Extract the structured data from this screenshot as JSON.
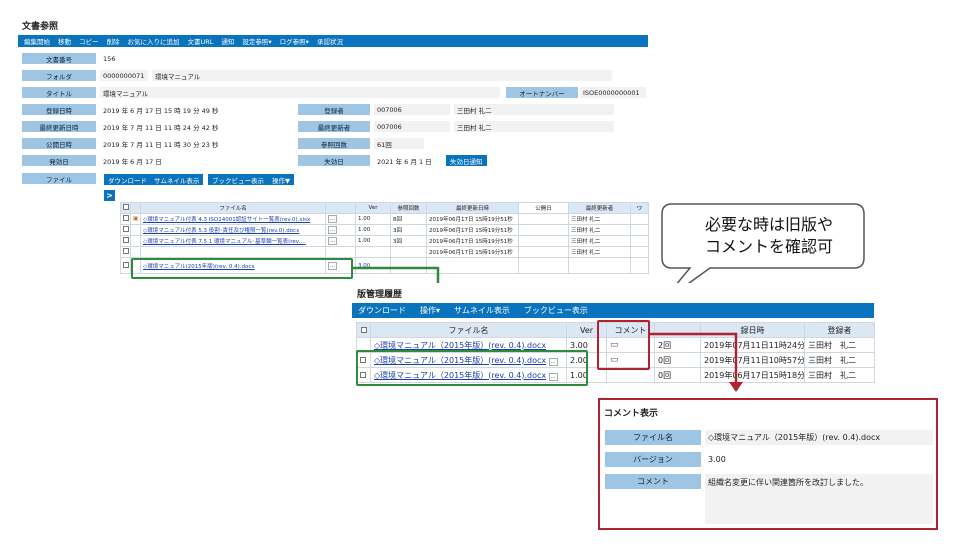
{
  "title": "文書参照",
  "menu": [
    "編集開始",
    "移動",
    "コピー",
    "削除",
    "お気に入りに追加",
    "文書URL",
    "通知",
    "設定参照▾",
    "ログ参照▾",
    "承認状況"
  ],
  "fields": {
    "doc_no_label": "文書番号",
    "doc_no": "156",
    "folder_label": "フォルダ",
    "folder_id": "0000000071",
    "folder_name": "環境マニュアル",
    "title_label": "タイトル",
    "title_value": "環境マニュアル",
    "auto_no_label": "オートナンバー",
    "auto_no": "ISOE0000000001",
    "reg_date_label": "登録日時",
    "reg_date": "2019 年  6  月 17  日  15  時 19  分  49  秒",
    "registrant_label": "登録者",
    "registrant_id": "007006",
    "registrant_name": "三田村 礼二",
    "upd_date_label": "最終更新日時",
    "upd_date": "2019 年  7  月 11  日  11  時 24  分  42  秒",
    "updater_label": "最終更新者",
    "updater_id": "007006",
    "updater_name": "三田村 礼二",
    "pub_date_label": "公開日時",
    "pub_date": "2019 年  7  月 11  日  11  時 30  分  23  秒",
    "ref_count_label": "参照回数",
    "ref_count": "61回",
    "eff_date_label": "発効日",
    "eff_date": "2019 年  6  月 17  日",
    "exp_date_label": "失効日",
    "exp_date": "2021  年  6  月  1  日",
    "exp_notice_button": "失効日通知",
    "file_label": "ファイル"
  },
  "file_buttons": [
    "ダウンロード",
    "サムネイル表示",
    "ブックビュー表示",
    "操作▼"
  ],
  "expand_icon": ">",
  "file_table": {
    "headers": [
      "",
      "",
      "ファイル名",
      "",
      "Ver",
      "参照回数",
      "最終更新日時",
      "公開日",
      "最終更新者",
      "ワ"
    ],
    "rows": [
      {
        "name": "◇環境マニュアル付表 4.3 ISO14001認証サイト一覧表(rev.0).xlsx",
        "ver": "1.00",
        "refs": "8回",
        "updated": "2019年06月17日 15時19分51秒",
        "updater": "三田村 礼二"
      },
      {
        "name": "◇環境マニュアル付表 5.3 役割･責任及び権限一覧(rev.0).docx",
        "ver": "1.00",
        "refs": "3回",
        "updated": "2019年06月17日 15時19分51秒",
        "updater": "三田村 礼二"
      },
      {
        "name": "◇環境マニュアル付表 7.5.1 環境マニュアル･基準類一覧表(rev.…",
        "ver": "1.00",
        "refs": "3回",
        "updated": "2019年06月17日 15時19分51秒",
        "updater": "三田村 礼二"
      },
      {
        "name": "",
        "ver": "",
        "refs": "",
        "updated": "2019年06月17日 15時19分51秒",
        "updater": "三田村 礼二"
      },
      {
        "name": "◇環境マニュアル(2015年版)(rev. 0.4).docx",
        "ver": "3.00",
        "refs": "",
        "updated": "",
        "updater": ""
      }
    ]
  },
  "callout": {
    "line1": "必要な時は旧版や",
    "line2": "コメントを確認可"
  },
  "history": {
    "title": "版管理履歴",
    "toolbar": [
      "ダウンロード",
      "操作▾",
      "サムネイル表示",
      "ブックビュー表示"
    ],
    "headers": [
      "",
      "ファイル名",
      "Ver",
      "コメント",
      "",
      "録日時",
      "登録者"
    ],
    "rows": [
      {
        "name": "◇環境マニュアル（2015年版）(rev. 0.4).docx",
        "ver": "3.00",
        "refs": "2回",
        "date": "2019年07月11日11時24分0…",
        "user": "三田村　礼二"
      },
      {
        "name": "◇環境マニュアル（2015年版）(rev. 0.4).docx",
        "ver": "2.00",
        "refs": "0回",
        "date": "2019年07月11日10時57分5…",
        "user": "三田村　礼二"
      },
      {
        "name": "◇環境マニュアル（2015年版）(rev. 0.4).docx",
        "ver": "1.00",
        "refs": "0回",
        "date": "2019年06月17日15時18分4…",
        "user": "三田村　礼二"
      }
    ]
  },
  "comment_panel": {
    "title": "コメント表示",
    "file_label": "ファイル名",
    "file_value": "◇環境マニュアル（2015年版）(rev. 0.4).docx",
    "ver_label": "バージョン",
    "ver_value": "3.00",
    "comment_label": "コメント",
    "comment_value": "組織名変更に伴い関連箇所を改訂しました。"
  },
  "colors": {
    "accent": "#0a73bd",
    "label_bg": "#9ec5e3",
    "green": "#2e8b3e",
    "red": "#b0222f"
  }
}
